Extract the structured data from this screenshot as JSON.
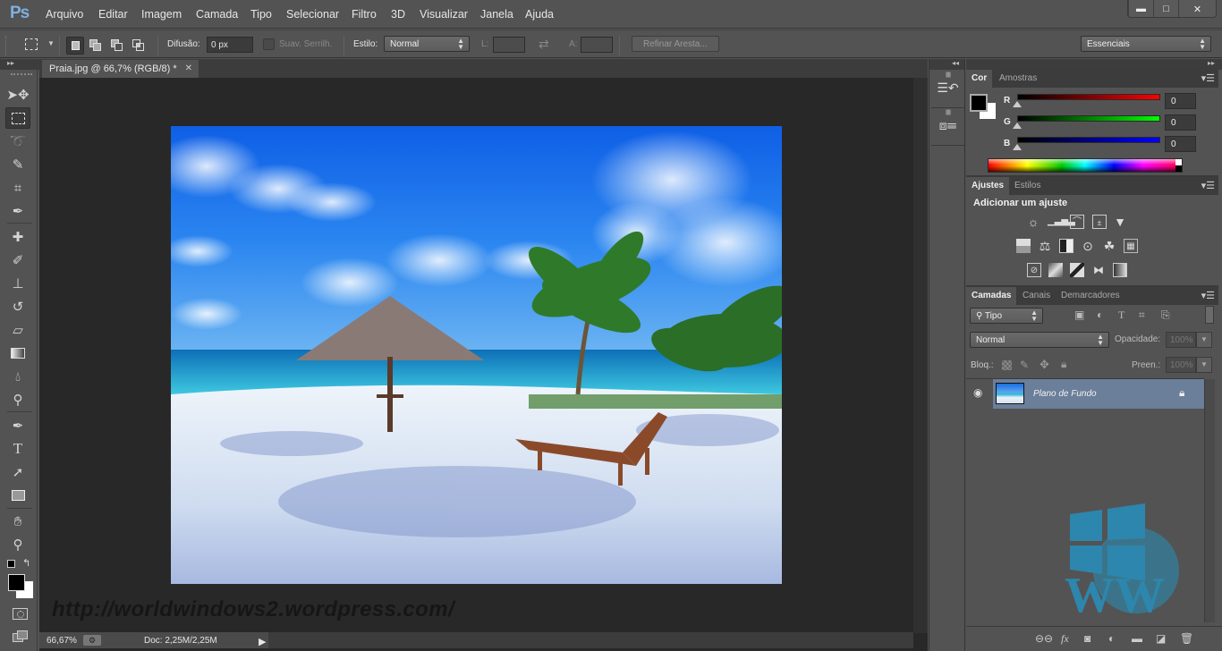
{
  "app": {
    "logo": "Ps"
  },
  "menu": [
    "Arquivo",
    "Editar",
    "Imagem",
    "Camada",
    "Tipo",
    "Selecionar",
    "Filtro",
    "3D",
    "Visualizar",
    "Janela",
    "Ajuda"
  ],
  "window_controls": {
    "minimize": "▬",
    "maximize": "□",
    "close": "✕"
  },
  "options_bar": {
    "feather_label": "Difusão:",
    "feather_value": "0 px",
    "antialias_label": "Suav. Serrilh.",
    "style_label": "Estilo:",
    "style_value": "Normal",
    "width_label": "L:",
    "width_value": "",
    "height_label": "A:",
    "height_value": "",
    "refine_edge": "Refinar Aresta...",
    "workspace": "Essenciais"
  },
  "tools": [
    "move",
    "rectangular-marquee",
    "lasso",
    "quick-selection",
    "crop",
    "eyedropper",
    "spot-healing",
    "brush",
    "clone-stamp",
    "history-brush",
    "eraser",
    "gradient",
    "blur",
    "dodge",
    "pen",
    "type",
    "path-selection",
    "rectangle",
    "hand",
    "zoom"
  ],
  "document": {
    "tab_title": "Praia.jpg @ 66,7% (RGB/8) *",
    "watermark": "http://worldwindows2.wordpress.com/",
    "zoom": "66,67%",
    "doc_size": "Doc: 2,25M/2,25M"
  },
  "color_panel": {
    "tabs": [
      "Cor",
      "Amostras"
    ],
    "foreground": "#000000",
    "background": "#ffffff",
    "channels": [
      {
        "label": "R",
        "value": "0",
        "color": "#ff0000"
      },
      {
        "label": "G",
        "value": "0",
        "color": "#00ff00"
      },
      {
        "label": "B",
        "value": "0",
        "color": "#0000ff"
      }
    ]
  },
  "adjustments_panel": {
    "tabs": [
      "Ajustes",
      "Estilos"
    ],
    "heading": "Adicionar um ajuste"
  },
  "layers_panel": {
    "tabs": [
      "Camadas",
      "Canais",
      "Demarcadores"
    ],
    "filter_kind": "Tipo",
    "blend_mode": "Normal",
    "opacity_label": "Opacidade:",
    "opacity_value": "100%",
    "lock_label": "Bloq.:",
    "fill_label": "Preen.:",
    "fill_value": "100%",
    "layers": [
      {
        "name": "Plano de Fundo",
        "visible": true,
        "locked": true
      }
    ]
  },
  "brand_colors": {
    "logo_blue": "#2d86ad",
    "ps_blue": "#7fb0e0"
  }
}
